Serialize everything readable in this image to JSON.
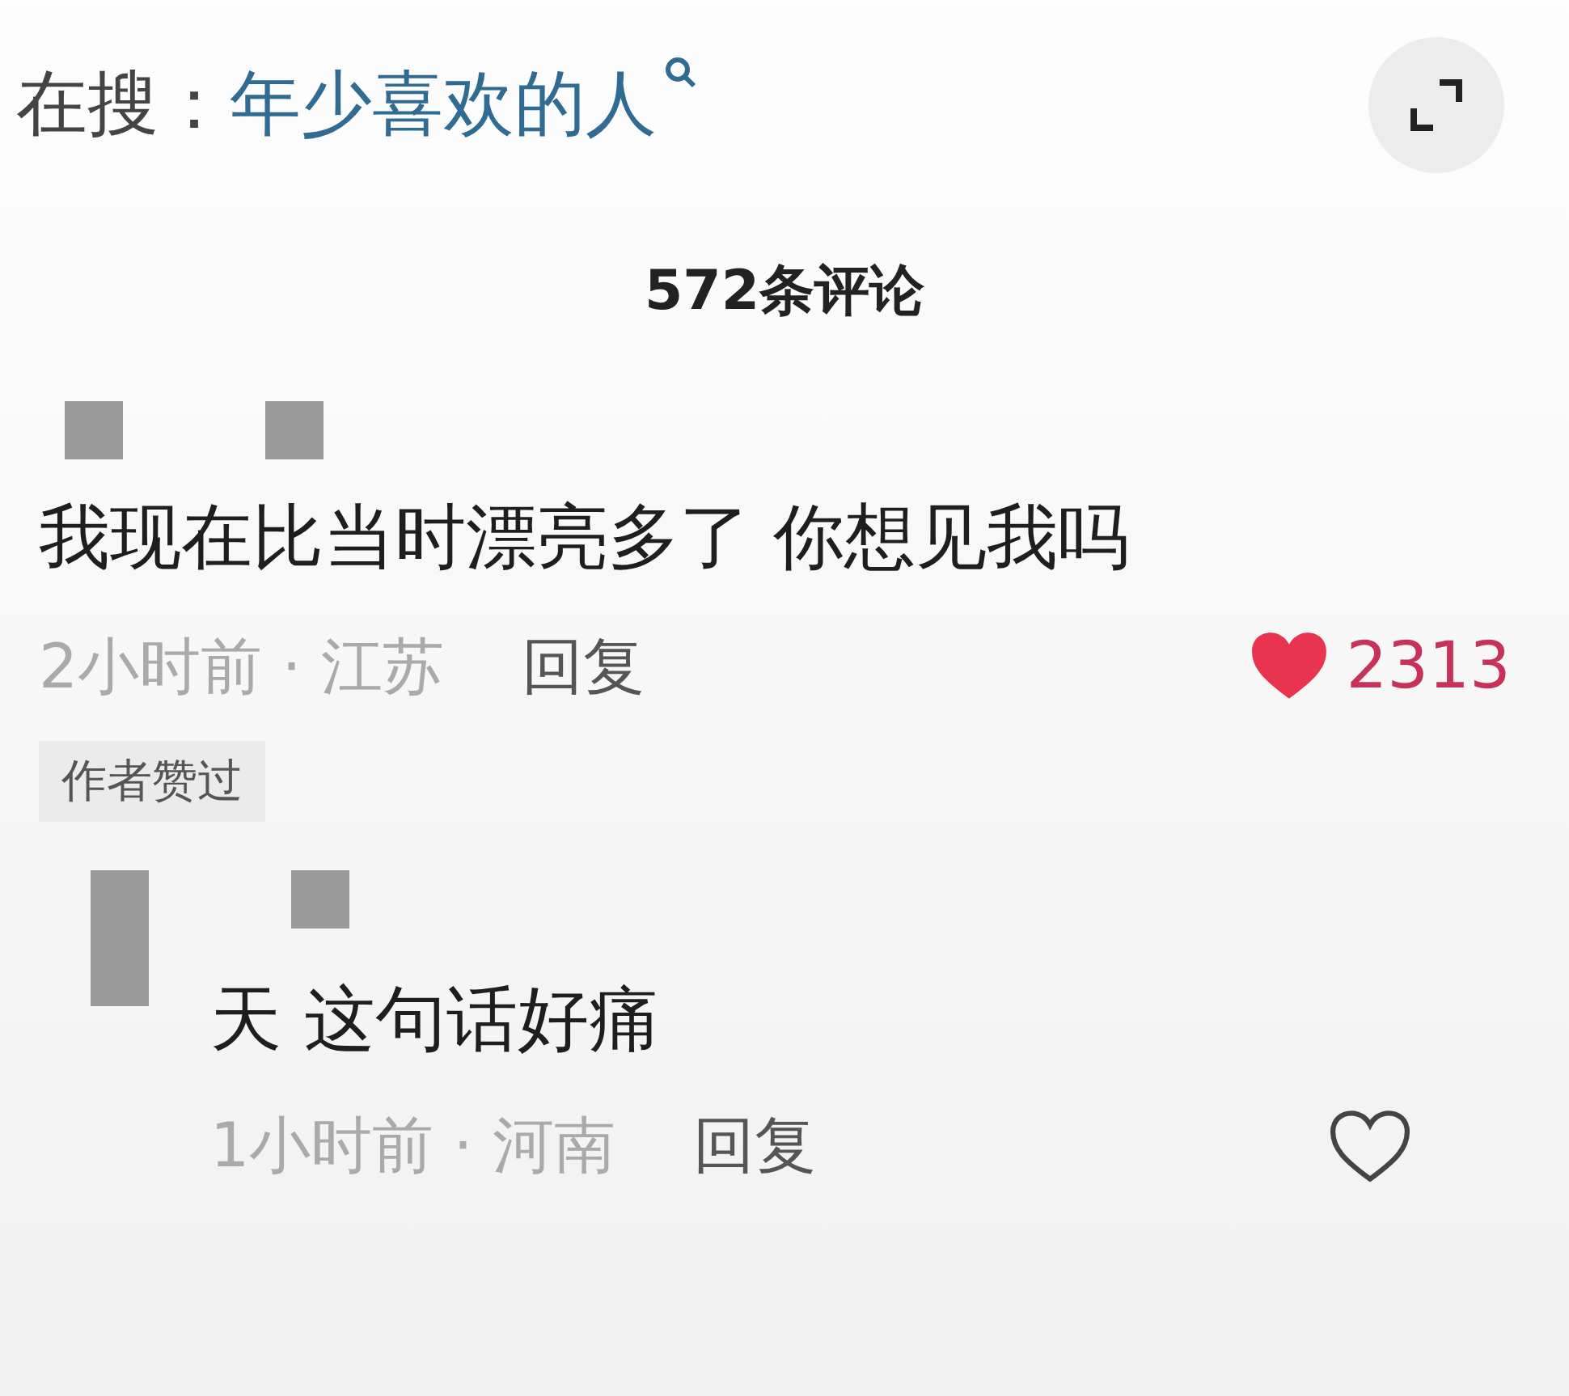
{
  "search_bar": {
    "label": "在搜：",
    "query": "年少喜欢的人"
  },
  "comment_count": "572条评论",
  "comments": [
    {
      "kind": "comment",
      "text": "我现在比当时漂亮多了 你想见我吗",
      "meta": "2小时前 · 江苏",
      "reply": "回复",
      "liked": true,
      "likes": "2313",
      "badge": "作者赞过"
    },
    {
      "kind": "reply",
      "text": "天 这句话好痛",
      "meta": "1小时前 · 河南",
      "reply": "回复",
      "liked": false
    }
  ]
}
